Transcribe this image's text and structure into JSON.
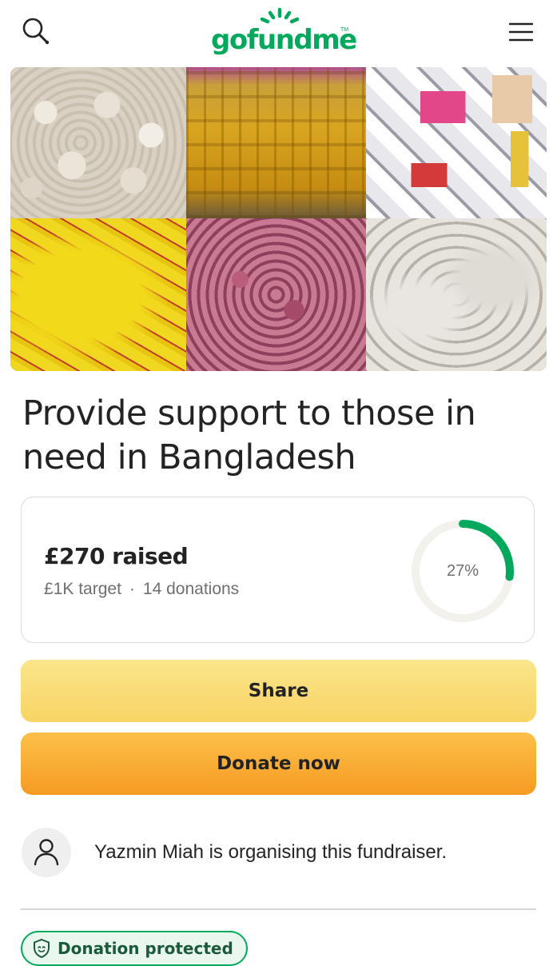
{
  "header": {
    "search_icon": "search-icon",
    "logo_text": "gofundme",
    "logo_tm": "TM",
    "menu_icon": "hamburger-menu-icon"
  },
  "gallery": {
    "tiles": [
      "garlic-bags",
      "cooking-oil-bottles",
      "grocery-items",
      "yellow-packets",
      "onion-bags",
      "rice-sacks"
    ]
  },
  "campaign": {
    "title": "Provide support to those in need in Bangladesh"
  },
  "progress": {
    "raised_text": "£270 raised",
    "target_text": "£1K target",
    "separator": "·",
    "donations_text": "14 donations",
    "percent_label": "27%",
    "percent_value": 27,
    "ring_color": "#02a95c",
    "track_color": "#f2f1ec"
  },
  "actions": {
    "share_label": "Share",
    "donate_label": "Donate now"
  },
  "organiser": {
    "avatar_icon": "user-icon",
    "text": "Yazmin Miah is organising this fundraiser."
  },
  "protection": {
    "icon": "shield-icon",
    "label": "Donation protected"
  },
  "colors": {
    "brand_green": "#02a95c",
    "share_yellow": "#f8d464",
    "donate_orange": "#f69b22"
  }
}
